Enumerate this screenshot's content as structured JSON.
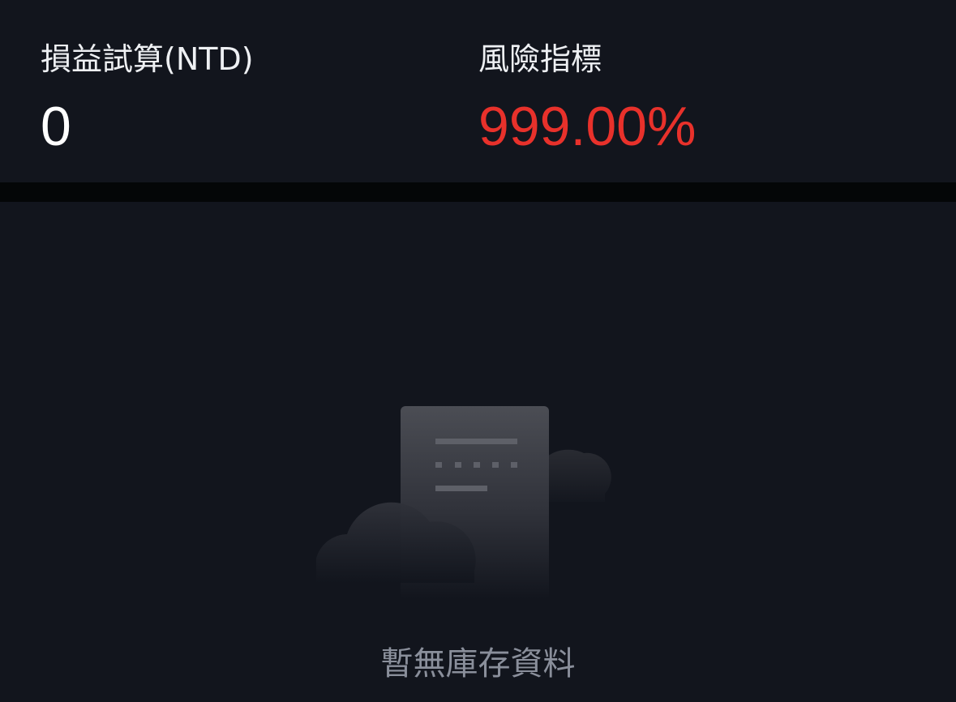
{
  "summary": {
    "pnl": {
      "label": "損益試算(NTD)",
      "value": "0"
    },
    "risk": {
      "label": "風險指標",
      "value": "999.00%"
    }
  },
  "empty_state": {
    "icon": "empty-document-cloud-icon",
    "message": "暫無庫存資料"
  },
  "colors": {
    "background": "#12151d",
    "divider": "#040607",
    "risk_value": "#e8312b",
    "primary_text": "#ffffff",
    "secondary_text": "#8a8f9b"
  }
}
